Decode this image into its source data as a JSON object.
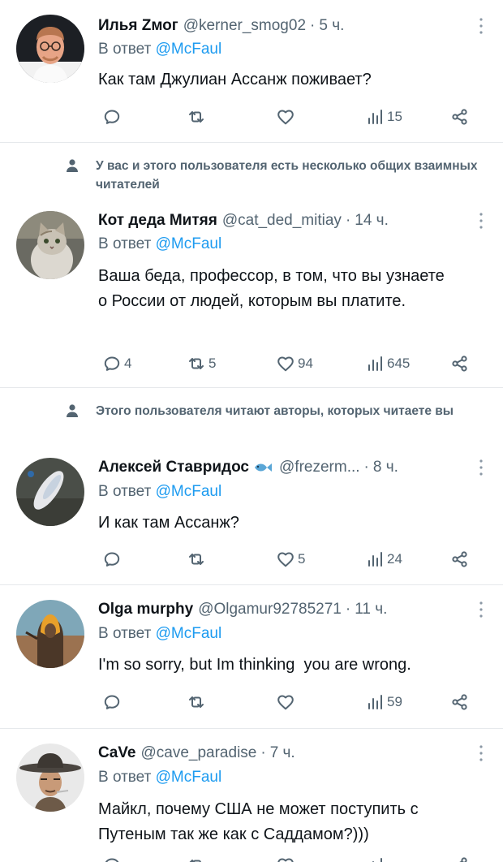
{
  "reply_prefix": "В ответ",
  "tweets": [
    {
      "name": "Илья Zмог",
      "handle": "@kerner_smog02",
      "time": "5 ч.",
      "reply_to": "@McFaul",
      "text": "Как там Джулиан Ассанж поживает?",
      "replies": "",
      "retweets": "",
      "likes": "",
      "views": "15",
      "avatar": "man-glasses-avatar"
    },
    {
      "social_context": "У вас и этого пользователя есть несколько общих взаимных читателей",
      "name": "Кот деда Митяя",
      "handle": "@cat_ded_mitiay",
      "time": "14 ч.",
      "reply_to": "@McFaul",
      "text": "Ваша беда, профессор, в том, что вы узнаете о России от людей, которым вы платите.",
      "replies": "4",
      "retweets": "5",
      "likes": "94",
      "views": "645",
      "avatar": "cat-avatar"
    },
    {
      "social_context": "Этого пользователя читают авторы, которых читаете вы",
      "name": "Алексей Ставридос",
      "handle": "@frezerm...",
      "time": "8 ч.",
      "reply_to": "@McFaul",
      "text": "И как там Ассанж?",
      "replies": "",
      "retweets": "",
      "likes": "5",
      "views": "24",
      "avatar": "fish-avatar"
    },
    {
      "name": "Olga murphy",
      "handle": "@Olgamur92785271",
      "time": "11 ч.",
      "reply_to": "@McFaul",
      "text": "I'm so sorry, but Im thinking  you are wrong.",
      "replies": "",
      "retweets": "",
      "likes": "",
      "views": "59",
      "avatar": "hooded-figure-avatar"
    },
    {
      "name": "CaVe",
      "handle": "@cave_paradise",
      "time": "7 ч.",
      "reply_to": "@McFaul",
      "text": "Майкл, почему США не может поступить с Путеным так же как с Саддамом?)))",
      "avatar": "cowboy-hat-avatar"
    }
  ],
  "colors": {
    "text": "#0f1419",
    "secondary": "#536471",
    "mention": "#1d9bf0",
    "divider": "#e6e9ec"
  }
}
